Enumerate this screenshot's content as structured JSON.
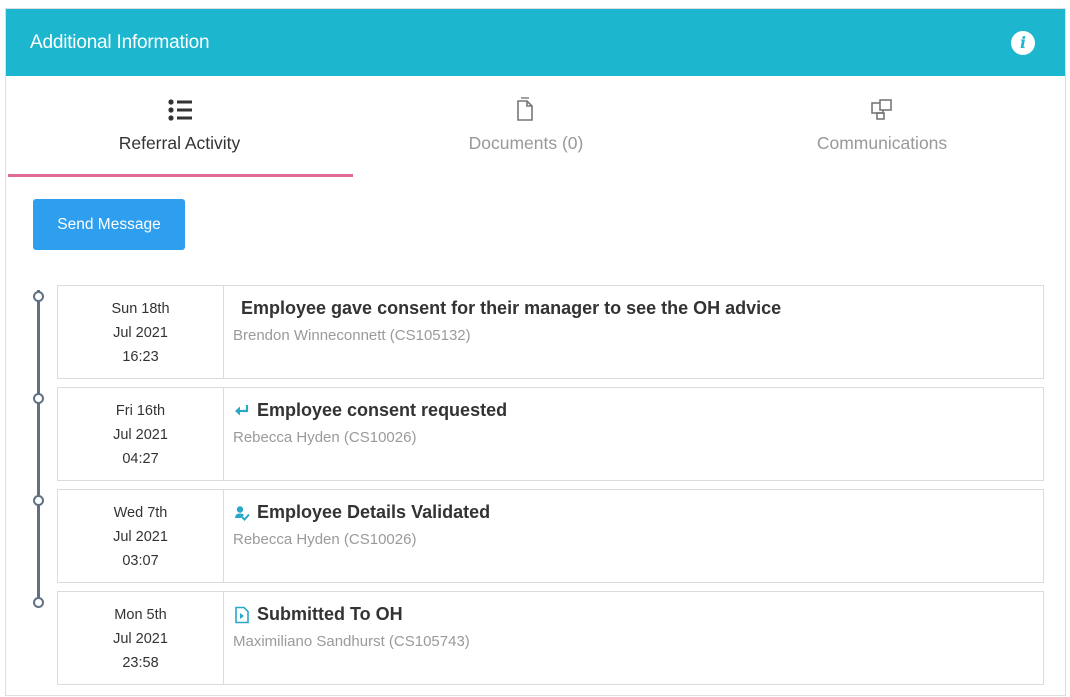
{
  "header": {
    "title": "Additional Information",
    "info_icon": "info-icon"
  },
  "tabs": [
    {
      "label": "Referral Activity",
      "icon": "list-icon",
      "active": true
    },
    {
      "label": "Documents (0)",
      "icon": "document-icon",
      "active": false
    },
    {
      "label": "Communications",
      "icon": "communications-icon",
      "active": false
    }
  ],
  "send_message_label": "Send Message",
  "colors": {
    "header_bg": "#1cb6cf",
    "active_tab_underline": "#e06b98",
    "button_bg": "#2e9fee",
    "timeline": "#5f7182",
    "activity_icon": "#2aa8c8"
  },
  "activities": [
    {
      "day": "Sun 18th",
      "month_year": "Jul 2021",
      "time": "16:23",
      "title": "Employee gave consent for their manager to see the OH advice",
      "user": "Brendon Winneconnett (CS105132)",
      "icon": "none"
    },
    {
      "day": "Fri 16th",
      "month_year": "Jul 2021",
      "time": "04:27",
      "title": "Employee consent requested",
      "user": "Rebecca Hyden (CS10026)",
      "icon": "reply-arrow-icon"
    },
    {
      "day": "Wed 7th",
      "month_year": "Jul 2021",
      "time": "03:07",
      "title": "Employee Details Validated",
      "user": "Rebecca Hyden (CS10026)",
      "icon": "user-check-icon"
    },
    {
      "day": "Mon 5th",
      "month_year": "Jul 2021",
      "time": "23:58",
      "title": "Submitted To OH",
      "user": "Maximiliano Sandhurst (CS105743)",
      "icon": "document-send-icon"
    }
  ]
}
